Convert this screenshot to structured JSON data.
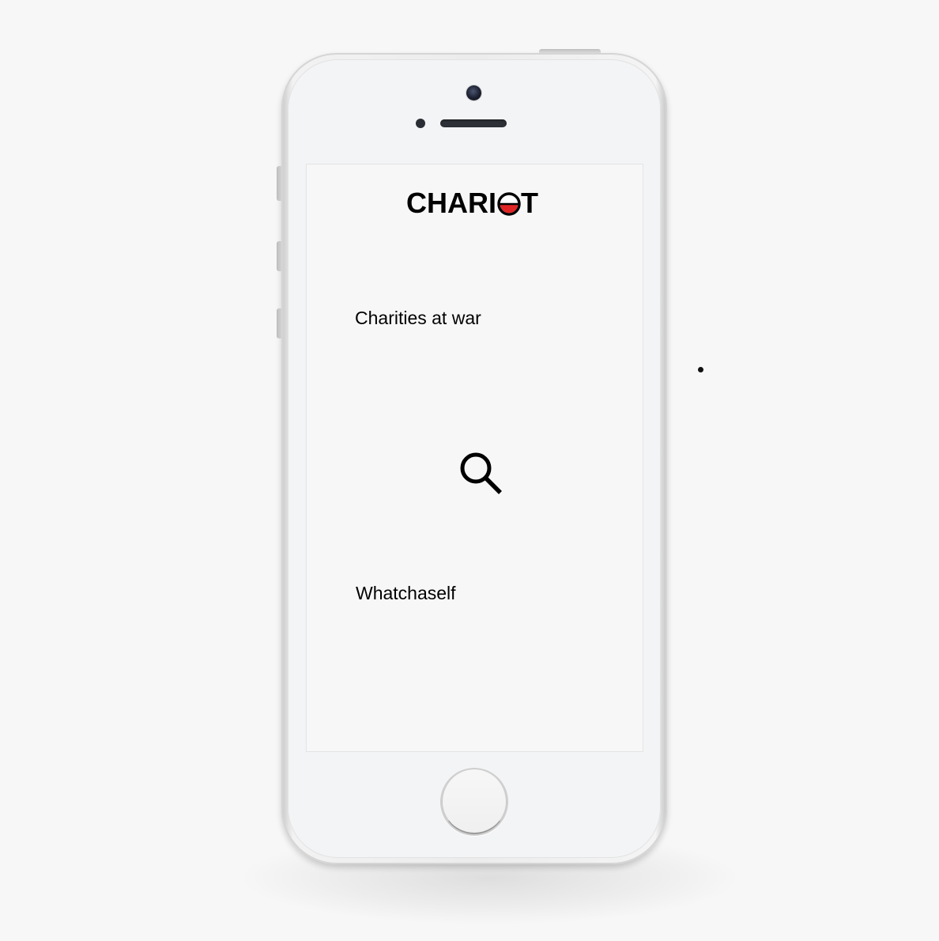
{
  "app": {
    "logo_text_prefix": "CHARI",
    "logo_text_suffix": "T",
    "logo_accent_color": "#e02424"
  },
  "screen": {
    "menu": [
      {
        "label": "Charities at war"
      },
      {
        "label": "Whatchaself"
      }
    ],
    "search_icon": "search-icon"
  },
  "device": {
    "home_button_icon": "home-button"
  }
}
